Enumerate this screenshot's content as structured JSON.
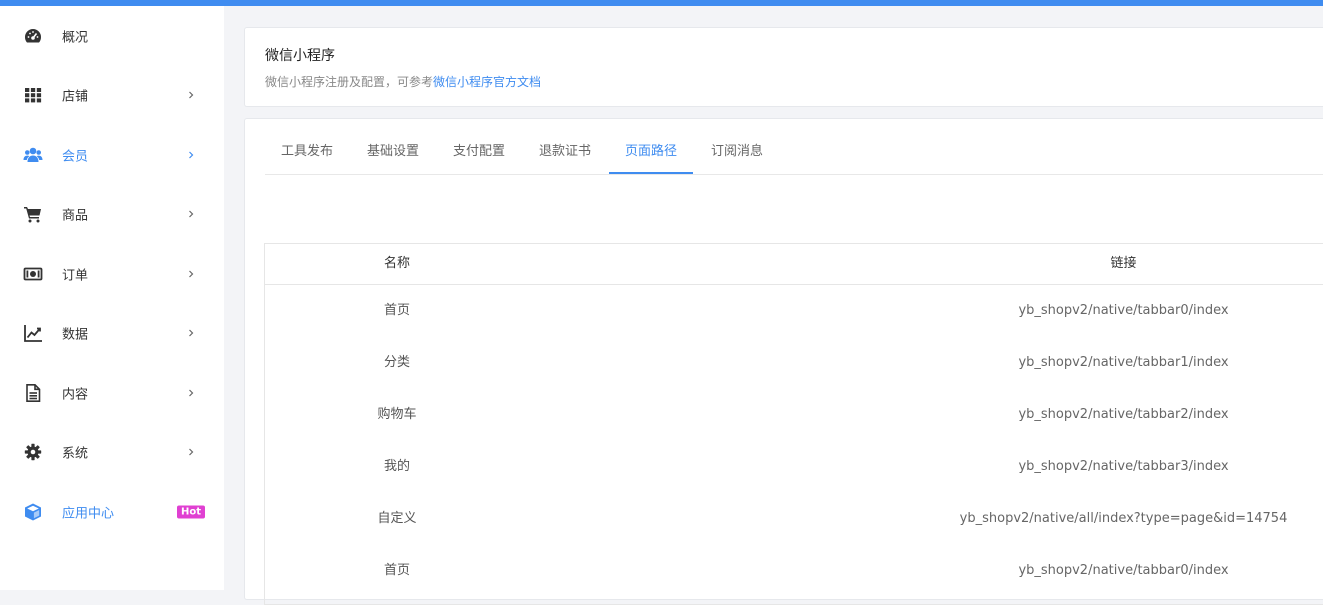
{
  "sidebar": {
    "items": [
      {
        "label": "概况",
        "icon": "dashboard-icon"
      },
      {
        "label": "店铺",
        "icon": "grid-icon"
      },
      {
        "label": "会员",
        "icon": "users-icon",
        "active": true
      },
      {
        "label": "商品",
        "icon": "cart-icon"
      },
      {
        "label": "订单",
        "icon": "money-icon"
      },
      {
        "label": "数据",
        "icon": "line-chart-icon"
      },
      {
        "label": "内容",
        "icon": "document-icon"
      },
      {
        "label": "系统",
        "icon": "gear-icon"
      },
      {
        "label": "应用中心",
        "icon": "cube-icon",
        "badge": "Hot"
      }
    ]
  },
  "header": {
    "title": "微信小程序",
    "subtitle": "微信小程序注册及配置，可参考",
    "doc_link": "微信小程序官方文档"
  },
  "tabs": [
    {
      "label": "工具发布"
    },
    {
      "label": "基础设置"
    },
    {
      "label": "支付配置"
    },
    {
      "label": "退款证书"
    },
    {
      "label": "页面路径",
      "active": true
    },
    {
      "label": "订阅消息"
    }
  ],
  "table": {
    "headers": {
      "name": "名称",
      "link": "链接"
    },
    "rows": [
      {
        "name": "首页",
        "link": "yb_shopv2/native/tabbar0/index"
      },
      {
        "name": "分类",
        "link": "yb_shopv2/native/tabbar1/index"
      },
      {
        "name": "购物车",
        "link": "yb_shopv2/native/tabbar2/index"
      },
      {
        "name": "我的",
        "link": "yb_shopv2/native/tabbar3/index"
      },
      {
        "name": "自定义",
        "link": "yb_shopv2/native/all/index?type=page&id=14754"
      },
      {
        "name": "首页",
        "link": "yb_shopv2/native/tabbar0/index"
      }
    ]
  },
  "colors": {
    "accent": "#3f8cf0",
    "badge": "#e040d2",
    "icon": "#333333"
  }
}
